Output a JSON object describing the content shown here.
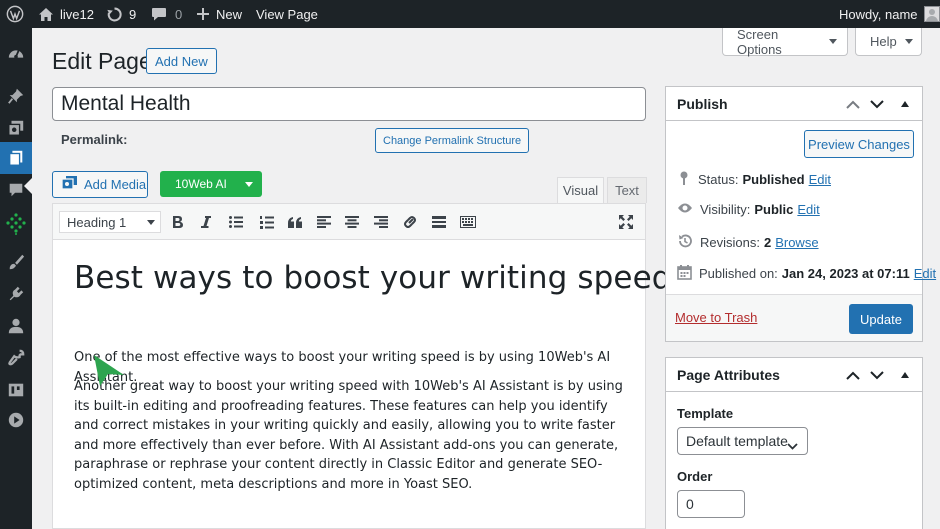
{
  "admin_bar": {
    "site_name": "live12",
    "updates_count": "9",
    "comments_count": "0",
    "new_label": "New",
    "view_page_label": "View Page",
    "howdy": "Howdy, name"
  },
  "screen_options": {
    "label": "Screen Options",
    "help_label": "Help"
  },
  "page": {
    "heading": "Edit Page",
    "add_new_label": "Add New",
    "title_value": "Mental Health",
    "permalink_label": "Permalink:",
    "change_permalink_label": "Change Permalink Structure"
  },
  "media": {
    "add_media_label": "Add Media",
    "ai_label": "10Web AI"
  },
  "editor": {
    "tab_visual": "Visual",
    "tab_text": "Text",
    "format_value": "Heading 1",
    "heading": "Best ways to boost your writing speed",
    "paragraph1": "One of the most effective ways to boost your writing speed is by using 10Web's AI Assistant.",
    "paragraph2": "Another great way to boost your writing speed with 10Web's AI Assistant is by using its built-in editing and proofreading features. These features can help you identify and correct mistakes in your writing quickly and easily, allowing you  to write faster and more effectively than ever before. With AI Assistant add-ons you can generate, paraphrase or rephrase your content directly in Classic Editor and generate SEO-optimized content, meta descriptions and more in Yoast SEO."
  },
  "publish": {
    "title": "Publish",
    "preview_label": "Preview Changes",
    "status_label": "Status:",
    "status_value": "Published",
    "visibility_label": "Visibility:",
    "visibility_value": "Public",
    "revisions_label": "Revisions:",
    "revisions_value": "2",
    "browse_label": "Browse",
    "published_on_label": "Published on:",
    "published_on_value": "Jan 24, 2023 at 07:11",
    "edit_label": "Edit",
    "trash_label": "Move to Trash",
    "update_label": "Update"
  },
  "page_attributes": {
    "title": "Page Attributes",
    "template_label": "Template",
    "template_value": "Default template",
    "order_label": "Order",
    "order_value": "0"
  },
  "colors": {
    "admin_bar_bg": "#1d2327",
    "accent": "#2271b1",
    "ai_button": "#22b14c",
    "trash": "#b32d2e",
    "cursor": "#2ea44f"
  },
  "icons": {
    "admin_bar": [
      "wordpress-logo-icon",
      "home-icon",
      "updates-icon",
      "comments-icon",
      "plus-icon"
    ],
    "side_menu": [
      "dashboard-icon",
      "posts-pin-icon",
      "media-icon",
      "pages-icon",
      "comments-icon",
      "10web-icon",
      "appearance-brush-icon",
      "plugins-icon",
      "users-icon",
      "tools-wrench-icon",
      "settings-icon",
      "play-icon"
    ]
  }
}
